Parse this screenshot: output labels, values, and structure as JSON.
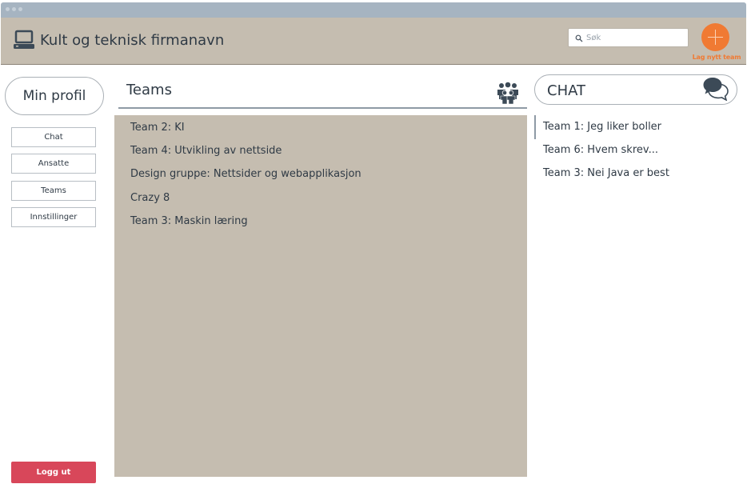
{
  "header": {
    "app_title": "Kult og teknisk firmanavn",
    "search_placeholder": "Søk",
    "add_team_label": "Lag nytt team"
  },
  "sidebar": {
    "profile_label": "Min profil",
    "items": [
      {
        "label": "Chat"
      },
      {
        "label": "Ansatte"
      },
      {
        "label": "Teams"
      },
      {
        "label": "Innstillinger"
      }
    ],
    "logout_label": "Logg ut"
  },
  "teams": {
    "title": "Teams",
    "items": [
      {
        "label": "Team 2: KI"
      },
      {
        "label": "Team 4: Utvikling av nettside"
      },
      {
        "label": "Design gruppe: Nettsider og webapplikasjon"
      },
      {
        "label": "Crazy 8"
      },
      {
        "label": "Team 3: Maskin læring"
      }
    ]
  },
  "chat": {
    "title": "CHAT",
    "items": [
      {
        "label": "Team 1: Jeg liker boller"
      },
      {
        "label": "Team 6: Hvem skrev..."
      },
      {
        "label": "Team 3: Nei Java er best"
      }
    ]
  },
  "colors": {
    "header_bg": "#c5bdb0",
    "titlebar_bg": "#a6b4c1",
    "accent_orange": "#f07a33",
    "logout_red": "#d8475a",
    "text_dark": "#2f3a45"
  },
  "icons": [
    "laptop-icon",
    "search-icon",
    "plus-icon",
    "people-group-icon",
    "chat-bubbles-icon"
  ]
}
